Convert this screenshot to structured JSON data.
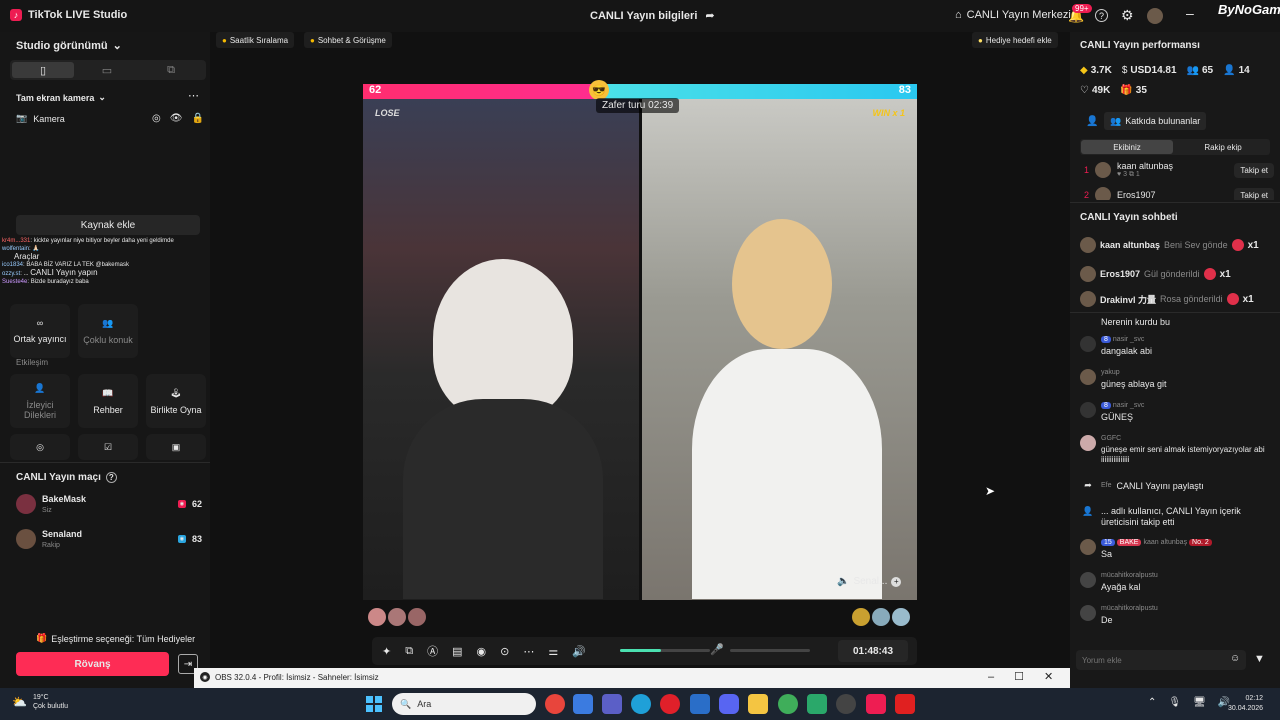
{
  "app": {
    "title": "TikTok LIVE Studio",
    "center_title": "CANLI Yayın bilgileri",
    "live_center": "CANLI Yayın Merkezi",
    "notif_count": "99+",
    "watermark": "ByNoGame"
  },
  "left": {
    "studio_view": "Studio görünümü",
    "fullscreen_camera": "Tam ekran kamera",
    "camera": "Kamera",
    "add_source": "Kaynak ekle",
    "tools_label": "Araçlar",
    "go_live_label": "CANLI Yayın yapın",
    "overlay_chat": [
      {
        "user": "kr4m...331",
        "text": "kickte yayınlar niye bitiyor beyler daha yeni geldimde"
      },
      {
        "user": "wolfentain",
        "text": "🙏🏻"
      },
      {
        "user": "ico1834",
        "text": "BABA BİZ VARIZ LA TEK @bakemask"
      },
      {
        "user": "ozzy.st",
        "text": "..."
      },
      {
        "user": "Sueste4e",
        "text": "Bizde buradayız baba"
      }
    ],
    "cohost": "Ortak yayıncı",
    "multi_guest": "Çoklu konuk",
    "interaction": "Etkileşim",
    "viewer_wishes": "İzleyici Dilekleri",
    "guide": "Rehber",
    "play_together": "Birlikte Oyna",
    "match_title": "CANLI Yayın maçı",
    "players": [
      {
        "name": "BakeMask",
        "sub": "Siz",
        "score": "62"
      },
      {
        "name": "Senaland",
        "sub": "Rakip",
        "score": "83"
      }
    ],
    "matching_option": "Eşleştirme seçeneği: Tüm Hediyeler",
    "rematch": "Rövanş"
  },
  "center": {
    "chip_hourly": "Saatlik Sıralama",
    "chip_chat": "Sohbet & Görüşme",
    "gift_goal": "Hediye hedefi ekle",
    "score_left": "62",
    "score_right": "83",
    "timer": "Zafer turu 02:39",
    "lose": "LOSE",
    "win": "WIN x 1",
    "guest_name": "Senal...",
    "duration": "01:48:43",
    "volume_level": 0.45
  },
  "obs": {
    "title": "OBS 32.0.4 - Profil: İsimsiz - Sahneler: İsimsiz"
  },
  "right": {
    "perf_title": "CANLI Yayın performansı",
    "stats": [
      "3.7K",
      "USD14.81",
      "65",
      "14",
      "49K",
      "35"
    ],
    "contributors": "Katkıda bulunanlar",
    "tab_team": "Ekibiniz",
    "tab_rival": "Rakip ekip",
    "top_users": [
      {
        "rank": "1",
        "name": "kaan altunbaş",
        "meta": "♥ 3  ⧉ 1",
        "action": "Takip et"
      },
      {
        "rank": "2",
        "name": "Eros1907",
        "meta": "",
        "action": "Takip et"
      }
    ],
    "chat_title": "CANLI Yayın sohbeti",
    "gifts": [
      {
        "name": "kaan altunbaş",
        "text": "Beni Sev gönde",
        "mult": "x1"
      },
      {
        "name": "Eros1907",
        "text": "Gül gönderildi",
        "mult": "x1"
      },
      {
        "name": "Drakinvl 力量",
        "text": "Rosa gönderildi",
        "mult": "x1"
      }
    ],
    "messages": [
      {
        "user": "",
        "text": "Nerenin kurdu bu",
        "badge": ""
      },
      {
        "user": "nasir _svc",
        "text": "dangalak abi",
        "badge": "8"
      },
      {
        "user": "yakup",
        "text": "güneş ablaya git",
        "badge": ""
      },
      {
        "user": "nasir _svc",
        "text": "GÜNEŞ",
        "badge": "8"
      },
      {
        "user": "GGFC",
        "text": "güneşe emir seni almak istemiyoryazıyolar abiiiiiiiiiiiiiiiii",
        "badge": ""
      },
      {
        "user": "Efe",
        "text": "CANLI Yayını paylaştı",
        "badge": ""
      },
      {
        "user": "...",
        "text": "adlı kullanıcı, CANLI Yayın içerik üreticisini takip etti",
        "badge": ""
      },
      {
        "user": "kaan altunbaş",
        "text": "Sa",
        "badge": "15"
      },
      {
        "user": "mücahitkoralpustu",
        "text": "Ayağa kal",
        "badge": ""
      },
      {
        "user": "mücahitkoralpustu",
        "text": "De",
        "badge": ""
      }
    ],
    "bake_tag": "BAKE",
    "no2": "No. 2",
    "comment_placeholder": "Yorum ekle"
  },
  "taskbar": {
    "temp": "19°C",
    "weather": "Çok bulutlu",
    "search": "Ara",
    "time": "02:12",
    "date": "30.04.2026"
  }
}
